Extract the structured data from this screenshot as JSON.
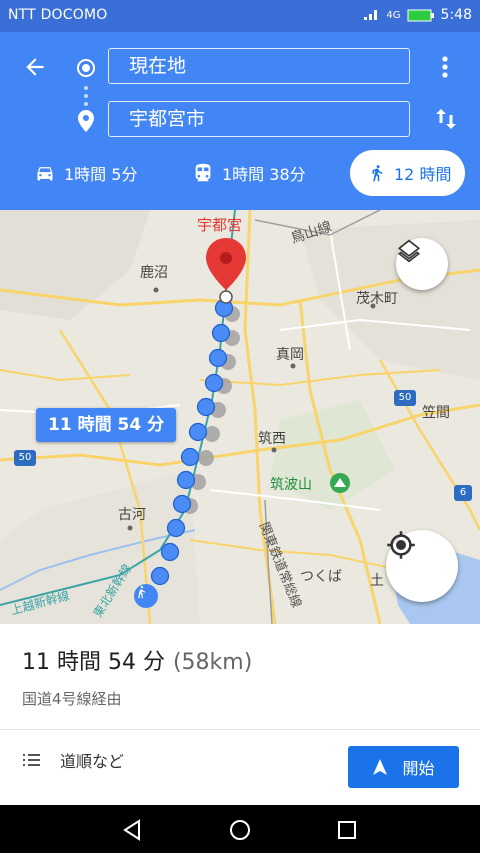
{
  "status_bar": {
    "carrier": "NTT DOCOMO",
    "network": "4G",
    "time": "5:48"
  },
  "header": {
    "origin": "現在地",
    "destination": "宇都宮市",
    "modes": [
      {
        "icon": "car-icon",
        "label": "1時間 5分"
      },
      {
        "icon": "train-icon",
        "label": "1時間 38分"
      },
      {
        "icon": "walk-icon",
        "label": "12 時間",
        "active": true
      }
    ]
  },
  "map": {
    "labels": [
      "宇都宮",
      "鳥山線",
      "鹿沼",
      "茂木町",
      "真岡",
      "笠間",
      "筑西",
      "筑波山",
      "古河",
      "関東鉄道常総線",
      "つくば",
      "土",
      "上越新幹線",
      "東北新幹線"
    ],
    "road_badges": [
      "50",
      "50",
      "6"
    ],
    "route_duration": "11 時間 54 分"
  },
  "sheet": {
    "duration": "11 時間 54 分",
    "distance": "(58km)",
    "via": "国道4号線経由",
    "steps_label": "道順など",
    "start_label": "開始"
  }
}
